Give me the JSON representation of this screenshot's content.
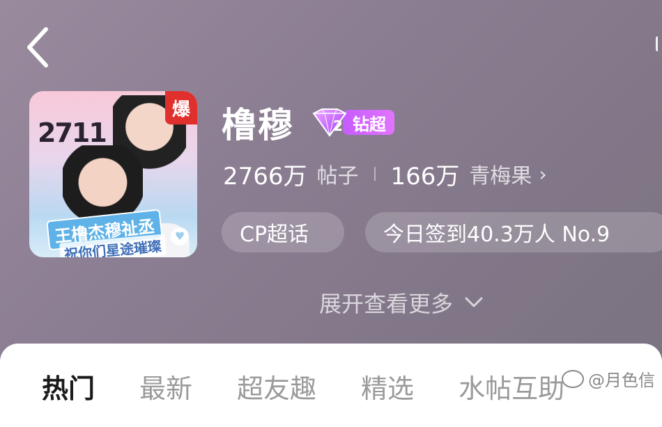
{
  "header": {
    "back_icon": "chevron-left-icon"
  },
  "topic": {
    "cover": {
      "count_text": "2711",
      "badge": "爆",
      "banner_line1": "王橹杰穆祉丞",
      "banner_line2": "祝你们星途璀璨"
    },
    "name": "橹穆",
    "level_badge": {
      "level": "2",
      "label": "钻超",
      "color": "#d066ff"
    },
    "stats": {
      "posts_value": "2766万",
      "posts_label": "帖子",
      "fans_value": "166万",
      "fans_label": "青梅果",
      "arrow": "›"
    },
    "chips": {
      "type": "CP超话",
      "checkin": "今日签到40.3万人 No.9"
    },
    "expand_label": "展开查看更多",
    "expand_icon": "chevron-down-icon"
  },
  "tabs": [
    {
      "label": "热门",
      "active": true
    },
    {
      "label": "最新"
    },
    {
      "label": "超友趣"
    },
    {
      "label": "精选"
    },
    {
      "label": "水帖互助"
    }
  ],
  "watermark": "@月色信"
}
